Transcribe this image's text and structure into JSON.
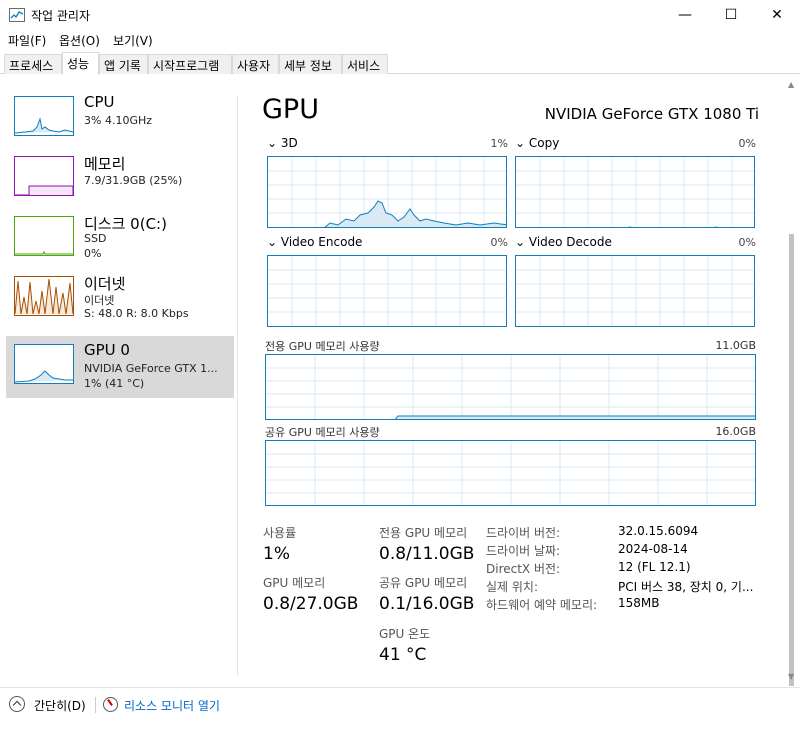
{
  "window": {
    "title": "작업 관리자",
    "minimize_glyph": "—",
    "maximize_glyph": "☐",
    "close_glyph": "✕"
  },
  "menu": [
    "파일(F)",
    "옵션(O)",
    "보기(V)"
  ],
  "tabs": [
    {
      "label": "프로세스"
    },
    {
      "label": "성능"
    },
    {
      "label": "앱 기록"
    },
    {
      "label": "시작프로그램"
    },
    {
      "label": "사용자"
    },
    {
      "label": "세부 정보"
    },
    {
      "label": "서비스"
    }
  ],
  "active_tab": "성능",
  "sidebar": {
    "items": [
      {
        "title": "CPU",
        "sub1": "3% 4.10GHz",
        "sub2": "",
        "sub3": "",
        "color": "#117dbb"
      },
      {
        "title": "메모리",
        "sub1": "7.9/31.9GB (25%)",
        "sub2": "",
        "sub3": "",
        "color": "#8b12ae"
      },
      {
        "title": "디스크 0(C:)",
        "sub1": "SSD",
        "sub2": "0%",
        "sub3": "",
        "color": "#4da60c"
      },
      {
        "title": "이더넷",
        "sub1": "이더넷",
        "sub2": "S: 48.0  R: 8.0 Kbps",
        "sub3": "",
        "color": "#a74f01"
      },
      {
        "title": "GPU 0",
        "sub1": "NVIDIA GeForce GTX 1...",
        "sub2": "1% (41 °C)",
        "sub3": "",
        "color": "#117dbb"
      }
    ],
    "selected_index": 4
  },
  "gpu": {
    "heading": "GPU",
    "model": "NVIDIA GeForce GTX 1080 Ti",
    "engines": [
      {
        "label": "3D",
        "pct": "1%"
      },
      {
        "label": "Copy",
        "pct": "0%"
      },
      {
        "label": "Video Encode",
        "pct": "0%"
      },
      {
        "label": "Video Decode",
        "pct": "0%"
      }
    ],
    "dedicated_memory": {
      "label": "전용 GPU 메모리 사용량",
      "max": "11.0GB"
    },
    "shared_memory": {
      "label": "공유 GPU 메모리 사용량",
      "max": "16.0GB"
    },
    "stats": {
      "utilization_label": "사용률",
      "utilization_value": "1%",
      "gpu_memory_label": "GPU 메모리",
      "gpu_memory_value": "0.8/27.0GB",
      "dedicated_label": "전용 GPU 메모리",
      "dedicated_value": "0.8/11.0GB",
      "shared_label": "공유 GPU 메모리",
      "shared_value": "0.1/16.0GB",
      "temp_label": "GPU 온도",
      "temp_value": "41 °C"
    },
    "info": [
      {
        "key": "드라이버 버전:",
        "value": "32.0.15.6094"
      },
      {
        "key": "드라이버 날짜:",
        "value": "2024-08-14"
      },
      {
        "key": "DirectX 버전:",
        "value": "12 (FL 12.1)"
      },
      {
        "key": "실제 위치:",
        "value": "PCI 버스 38, 장치 0, 기..."
      },
      {
        "key": "하드웨어 예약 메모리:",
        "value": "158MB"
      }
    ]
  },
  "footer": {
    "collapse_label": "간단히(D)",
    "monitor_label": "리소스 모니터 열기"
  },
  "colors": {
    "graph_blue": "#117dbb",
    "grid": "#d9eaf4",
    "link": "#0066cc"
  }
}
